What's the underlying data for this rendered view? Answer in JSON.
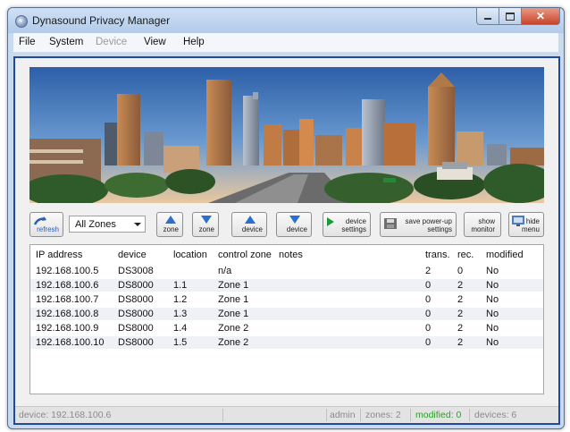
{
  "window": {
    "title": "Dynasound Privacy Manager"
  },
  "menu": [
    {
      "label": "File",
      "enabled": true
    },
    {
      "label": "System",
      "enabled": true
    },
    {
      "label": "Device",
      "enabled": false
    },
    {
      "label": "View",
      "enabled": true
    },
    {
      "label": "Help",
      "enabled": true
    }
  ],
  "toolbar": {
    "refresh": "refresh",
    "zone_filter": "All Zones",
    "add_zone": "zone",
    "remove_zone": "zone",
    "add_device": "device",
    "remove_device": "device",
    "device_settings": [
      "device",
      "settings"
    ],
    "save_powerup": [
      "save power-up",
      "settings"
    ],
    "show_monitor": [
      "show",
      "monitor"
    ],
    "hide_menu": [
      "hide",
      "menu"
    ]
  },
  "table": {
    "columns": [
      "IP address",
      "device",
      "location",
      "control zone",
      "notes",
      "trans.",
      "rec.",
      "modified"
    ],
    "rows": [
      [
        "192.168.100.5",
        "DS3008",
        "",
        "n/a",
        "",
        "2",
        "0",
        "No"
      ],
      [
        "192.168.100.6",
        "DS8000",
        "1.1",
        "Zone 1",
        "",
        "0",
        "2",
        "No"
      ],
      [
        "192.168.100.7",
        "DS8000",
        "1.2",
        "Zone 1",
        "",
        "0",
        "2",
        "No"
      ],
      [
        "192.168.100.8",
        "DS8000",
        "1.3",
        "Zone 1",
        "",
        "0",
        "2",
        "No"
      ],
      [
        "192.168.100.9",
        "DS8000",
        "1.4",
        "Zone 2",
        "",
        "0",
        "2",
        "No"
      ],
      [
        "192.168.100.10",
        "DS8000",
        "1.5",
        "Zone 2",
        "",
        "0",
        "2",
        "No"
      ]
    ]
  },
  "status": {
    "device": "device: 192.168.100.6",
    "user": "admin",
    "zones": "zones: 2",
    "modified": "modified: 0",
    "devices": "devices: 6"
  },
  "colors": {
    "frame_blue": "#21489a",
    "status_green": "#2aa02a",
    "close_red": "#c8442a"
  },
  "icons": [
    "app-icon",
    "refresh-icon",
    "add-zone-icon",
    "remove-zone-icon",
    "add-device-icon",
    "remove-device-icon",
    "play-icon",
    "save-icon",
    "monitor-icon"
  ]
}
